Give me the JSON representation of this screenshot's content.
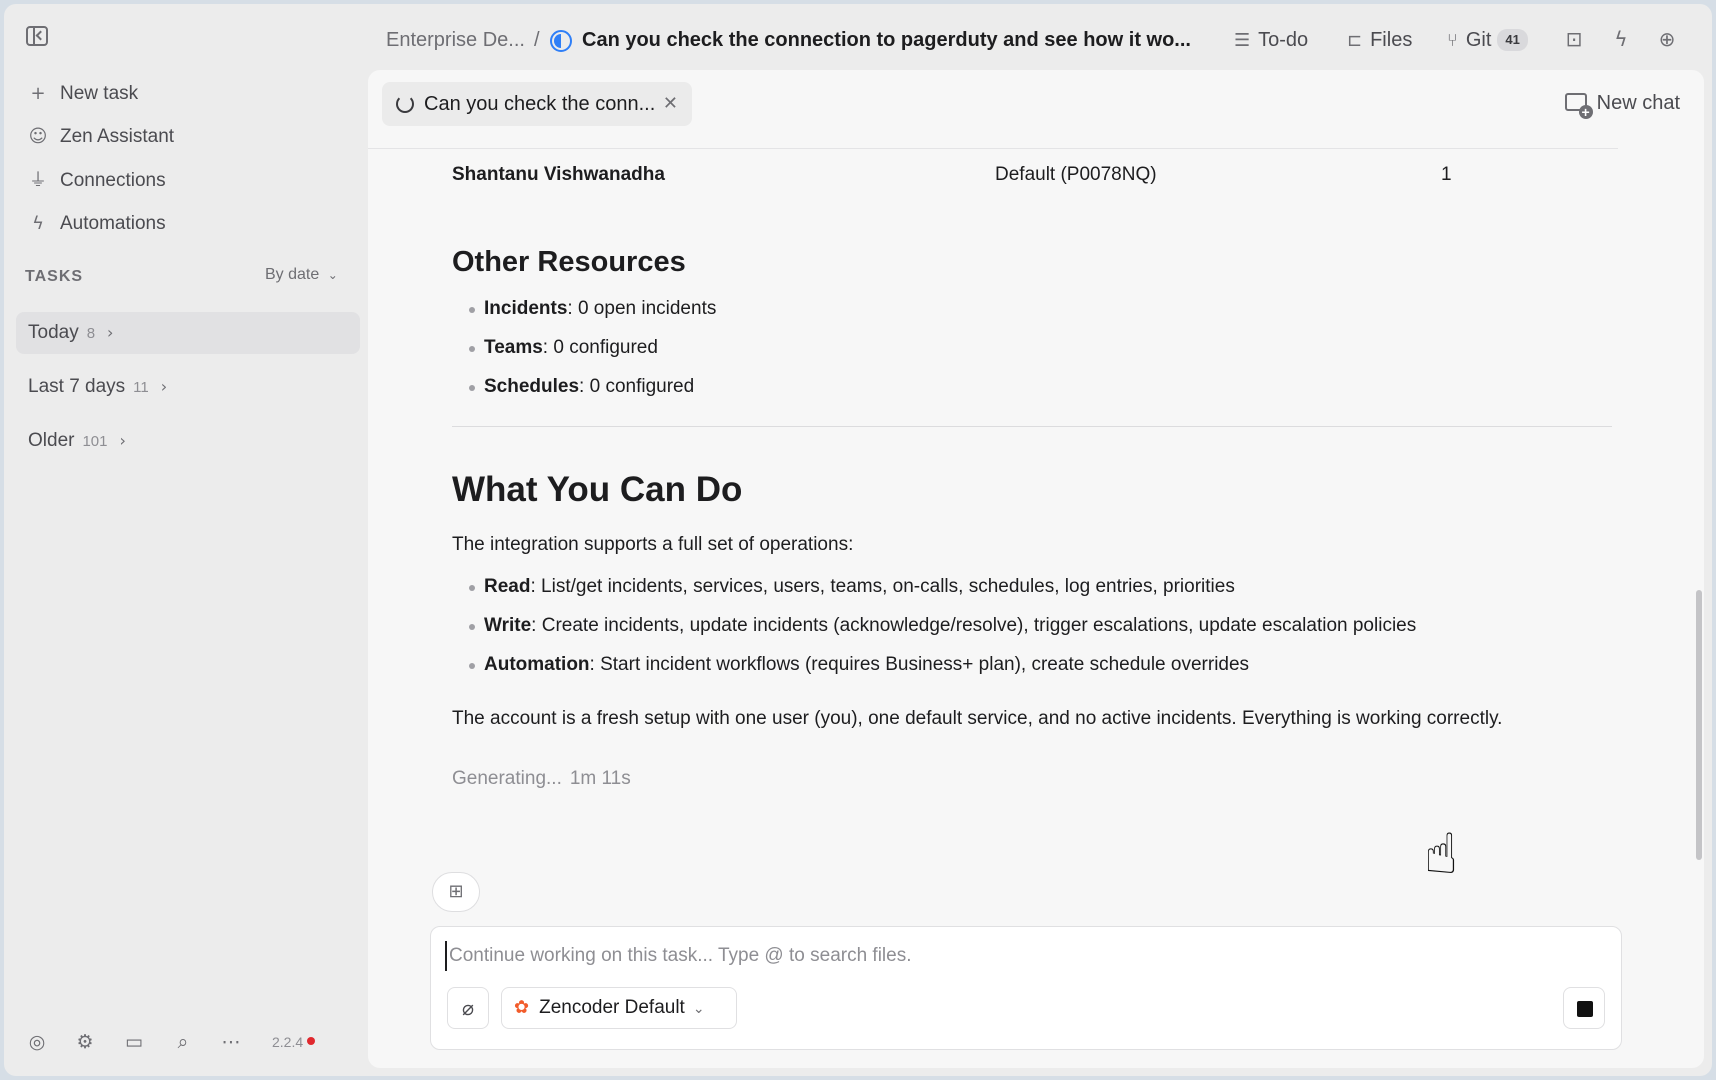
{
  "breadcrumb": {
    "project": "Enterprise De...",
    "separator": "/",
    "title": "Can you check the connection to pagerduty and see how it wo..."
  },
  "toolbar": {
    "todo_label": "To-do",
    "files_label": "Files",
    "git_label": "Git",
    "git_count": "41"
  },
  "sidebar": {
    "items": [
      {
        "label": "New task",
        "icon": "plus-icon"
      },
      {
        "label": "Zen Assistant",
        "icon": "robot-icon"
      },
      {
        "label": "Connections",
        "icon": "plug-icon"
      },
      {
        "label": "Automations",
        "icon": "bolt-icon"
      }
    ],
    "tasks_header": "TASKS",
    "sort_label": "By date",
    "groups": [
      {
        "label": "Today",
        "count": "8"
      },
      {
        "label": "Last 7 days",
        "count": "11"
      },
      {
        "label": "Older",
        "count": "101"
      }
    ],
    "version": "2.2.4"
  },
  "chat": {
    "tab_label": "Can you check the conn...",
    "new_chat_label": "New chat"
  },
  "content": {
    "table_row": {
      "name": "Shantanu Vishwanadha",
      "policy": "Default (P0078NQ)",
      "count": "1"
    },
    "other_heading": "Other Resources",
    "other_items": [
      {
        "key": "Incidents",
        "text": ": 0 open incidents"
      },
      {
        "key": "Teams",
        "text": ": 0 configured"
      },
      {
        "key": "Schedules",
        "text": ": 0 configured"
      }
    ],
    "what_heading": "What You Can Do",
    "intro": "The integration supports a full set of operations:",
    "ops": [
      {
        "key": "Read",
        "text": ": List/get incidents, services, users, teams, on-calls, schedules, log entries, priorities"
      },
      {
        "key": "Write",
        "text": ": Create incidents, update incidents (acknowledge/resolve), trigger escalations, update escalation policies"
      },
      {
        "key": "Automation",
        "text": ": Start incident workflows (requires Business+ plan), create schedule overrides"
      }
    ],
    "summary": "The account is a fresh setup with one user (you), one default service, and no active incidents. Everything is working correctly.",
    "generating": "Generating...",
    "elapsed": "1m 11s"
  },
  "composer": {
    "placeholder": "Continue working on this task... Type @ to search files.",
    "model": "Zencoder Default"
  },
  "colors": {
    "accent": "#2f7ff7",
    "version_dot": "#e0282e",
    "model_logo": "#f25c2b"
  }
}
